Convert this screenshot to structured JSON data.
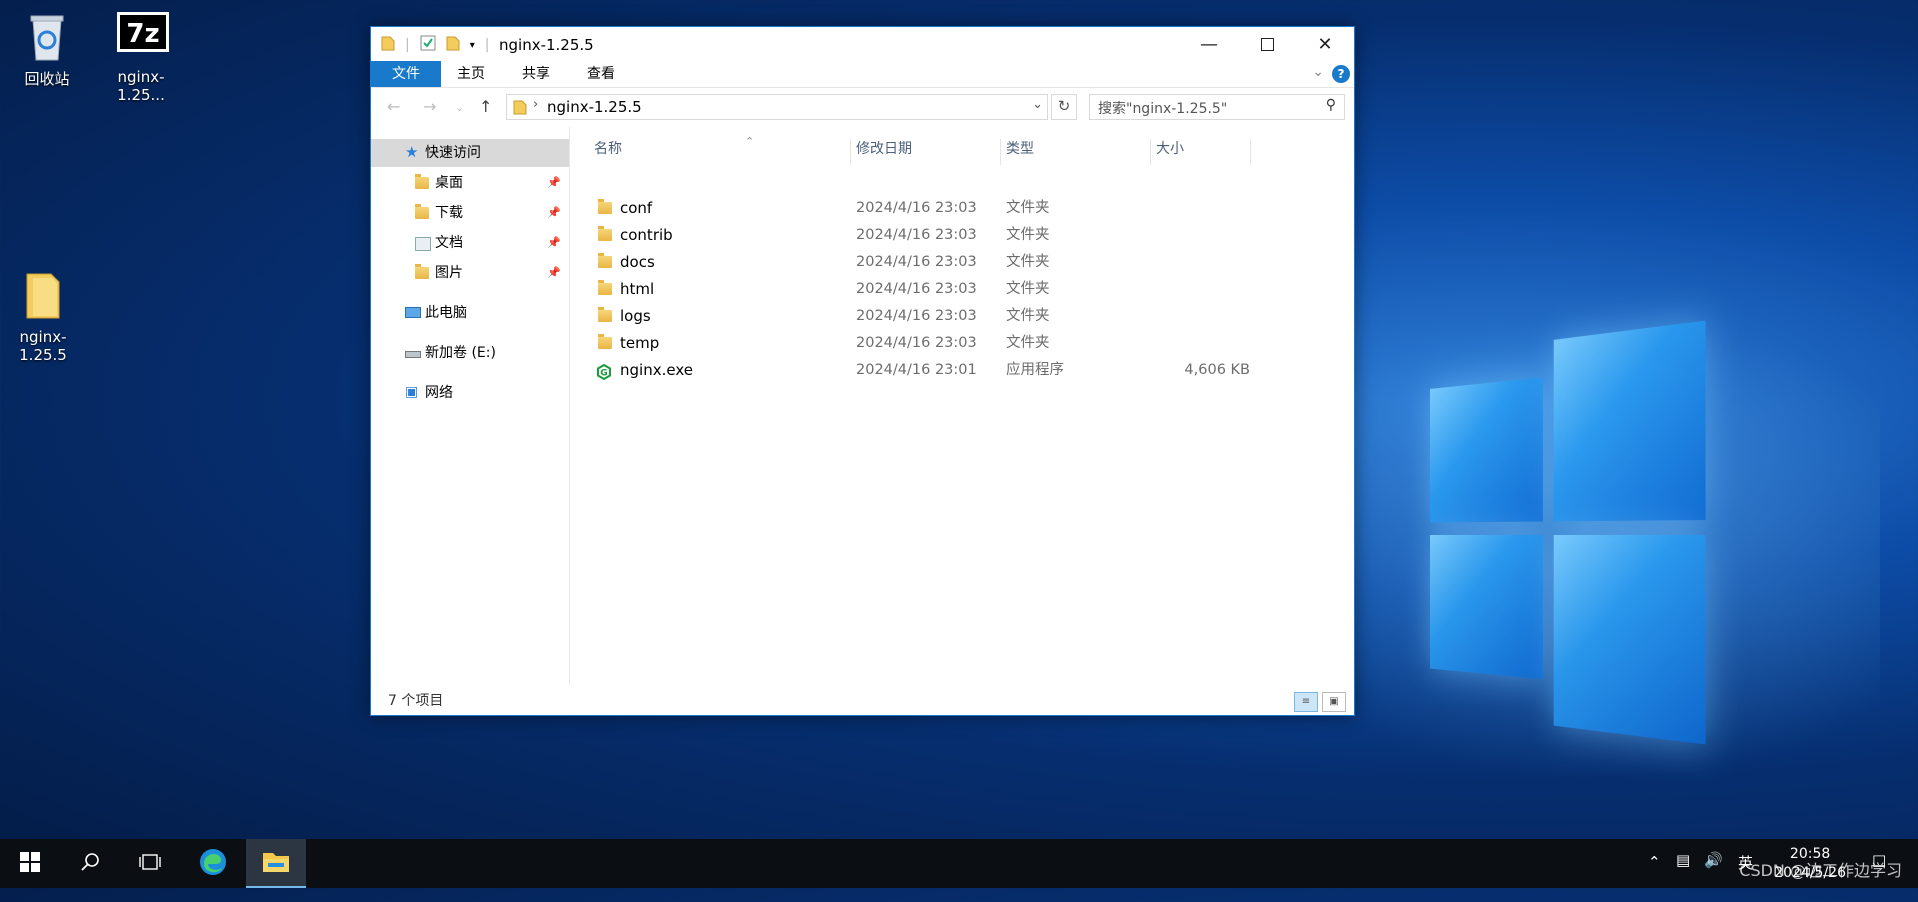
{
  "desktop": {
    "icons": [
      {
        "label": "回收站"
      },
      {
        "label": "nginx-1.25..."
      },
      {
        "label": "nginx-1.25.5"
      }
    ]
  },
  "window": {
    "title": "nginx-1.25.5",
    "ribbon_tabs": [
      "文件",
      "主页",
      "共享",
      "查看"
    ],
    "help_label": "?",
    "address": {
      "path": "nginx-1.25.5"
    },
    "search": {
      "placeholder": "搜索\"nginx-1.25.5\""
    },
    "nav_pane": [
      {
        "label": "快速访问",
        "icon": "star-icon"
      },
      {
        "label": "桌面",
        "icon": "desktop-folder-icon",
        "pinned": true
      },
      {
        "label": "下载",
        "icon": "download-folder-icon",
        "pinned": true
      },
      {
        "label": "文档",
        "icon": "documents-folder-icon",
        "pinned": true
      },
      {
        "label": "图片",
        "icon": "pictures-folder-icon",
        "pinned": true
      },
      {
        "label": "此电脑",
        "icon": "computer-icon"
      },
      {
        "label": "新加卷 (E:)",
        "icon": "drive-icon"
      },
      {
        "label": "网络",
        "icon": "network-icon"
      }
    ],
    "columns": {
      "name": "名称",
      "date": "修改日期",
      "type": "类型",
      "size": "大小"
    },
    "files": [
      {
        "name": "conf",
        "date": "2024/4/16 23:03",
        "type": "文件夹",
        "size": "",
        "icon": "folder-icon"
      },
      {
        "name": "contrib",
        "date": "2024/4/16 23:03",
        "type": "文件夹",
        "size": "",
        "icon": "folder-icon"
      },
      {
        "name": "docs",
        "date": "2024/4/16 23:03",
        "type": "文件夹",
        "size": "",
        "icon": "folder-icon"
      },
      {
        "name": "html",
        "date": "2024/4/16 23:03",
        "type": "文件夹",
        "size": "",
        "icon": "folder-icon"
      },
      {
        "name": "logs",
        "date": "2024/4/16 23:03",
        "type": "文件夹",
        "size": "",
        "icon": "folder-icon"
      },
      {
        "name": "temp",
        "date": "2024/4/16 23:03",
        "type": "文件夹",
        "size": "",
        "icon": "folder-icon"
      },
      {
        "name": "nginx.exe",
        "date": "2024/4/16 23:01",
        "type": "应用程序",
        "size": "4,606 KB",
        "icon": "nginx-exe-icon"
      }
    ],
    "status": {
      "count": "7 个项目"
    }
  },
  "taskbar": {
    "time": "20:58",
    "date": "2024/5/26",
    "ime": "英"
  },
  "watermark": "CSDN @边工作边学习",
  "colors": {
    "accent": "#1979ca",
    "taskbar": "#0b0f14"
  }
}
